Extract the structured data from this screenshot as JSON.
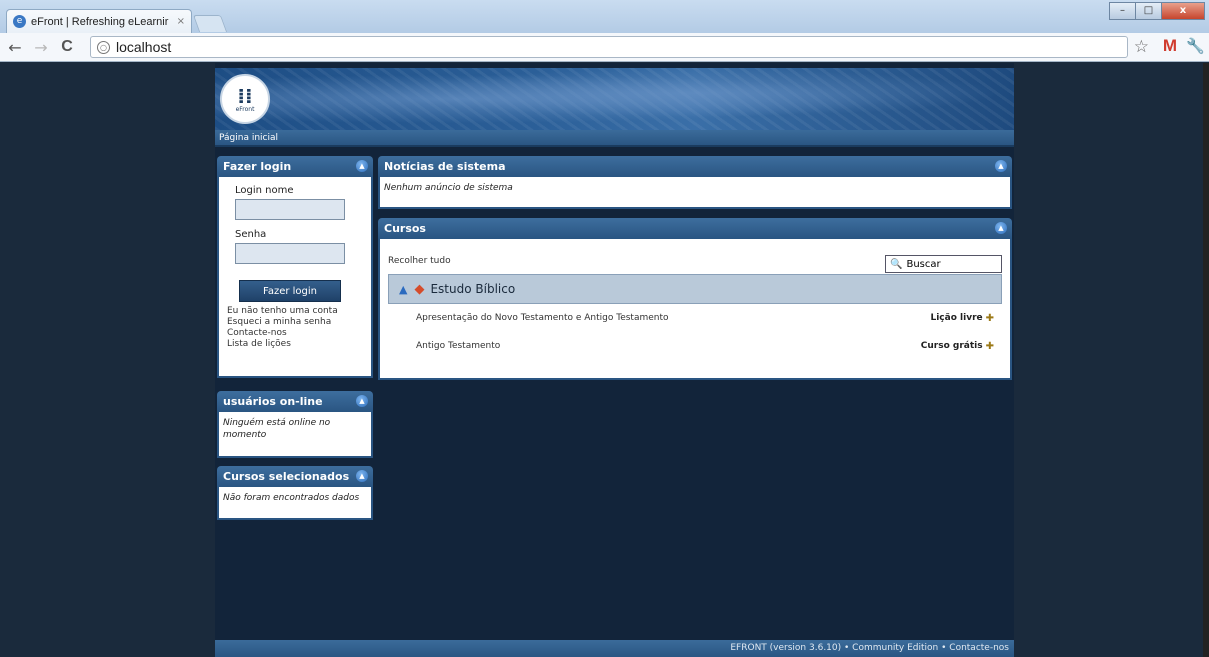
{
  "browser": {
    "tab_title": "eFront | Refreshing eLearnir",
    "tab_close": "×",
    "url": "localhost",
    "nav": {
      "back": "←",
      "forward": "→",
      "reload": "C"
    },
    "window_buttons": {
      "minimize": "–",
      "maximize": "□",
      "close": "x"
    }
  },
  "header": {
    "logo_glyph": "⁞⁞",
    "logo_text": "eFront",
    "home_link": "Página inicial"
  },
  "login_block": {
    "title": "Fazer login",
    "username_label": "Login nome",
    "password_label": "Senha",
    "submit_label": "Fazer login",
    "links": [
      "Eu não tenho uma conta",
      "Esqueci a minha senha",
      "Contacte-nos",
      "Lista de lições"
    ]
  },
  "online_block": {
    "title": "usuários on-line",
    "text": "Ninguém está online no momento"
  },
  "selected_block": {
    "title": "Cursos selecionados",
    "text": "Não foram encontrados dados"
  },
  "news_block": {
    "title": "Notícias de sistema",
    "text": "Nenhum anúncio de sistema"
  },
  "courses_block": {
    "title": "Cursos",
    "collapse_all": "Recolher tudo",
    "search_label": "Buscar",
    "category": "Estudo Bíblico",
    "courses": [
      {
        "name": "Apresentação do Novo Testamento e Antigo Testamento",
        "tag": "Lição livre"
      },
      {
        "name": "Antigo Testamento",
        "tag": "Curso grátis"
      }
    ]
  },
  "footer": {
    "text": "EFRONT (version 3.6.10) • Community Edition • Contacte-nos"
  },
  "colors": {
    "page_bg": "#12243a",
    "header_blue": "#2a5582",
    "category_bg": "#b9c9d9"
  }
}
